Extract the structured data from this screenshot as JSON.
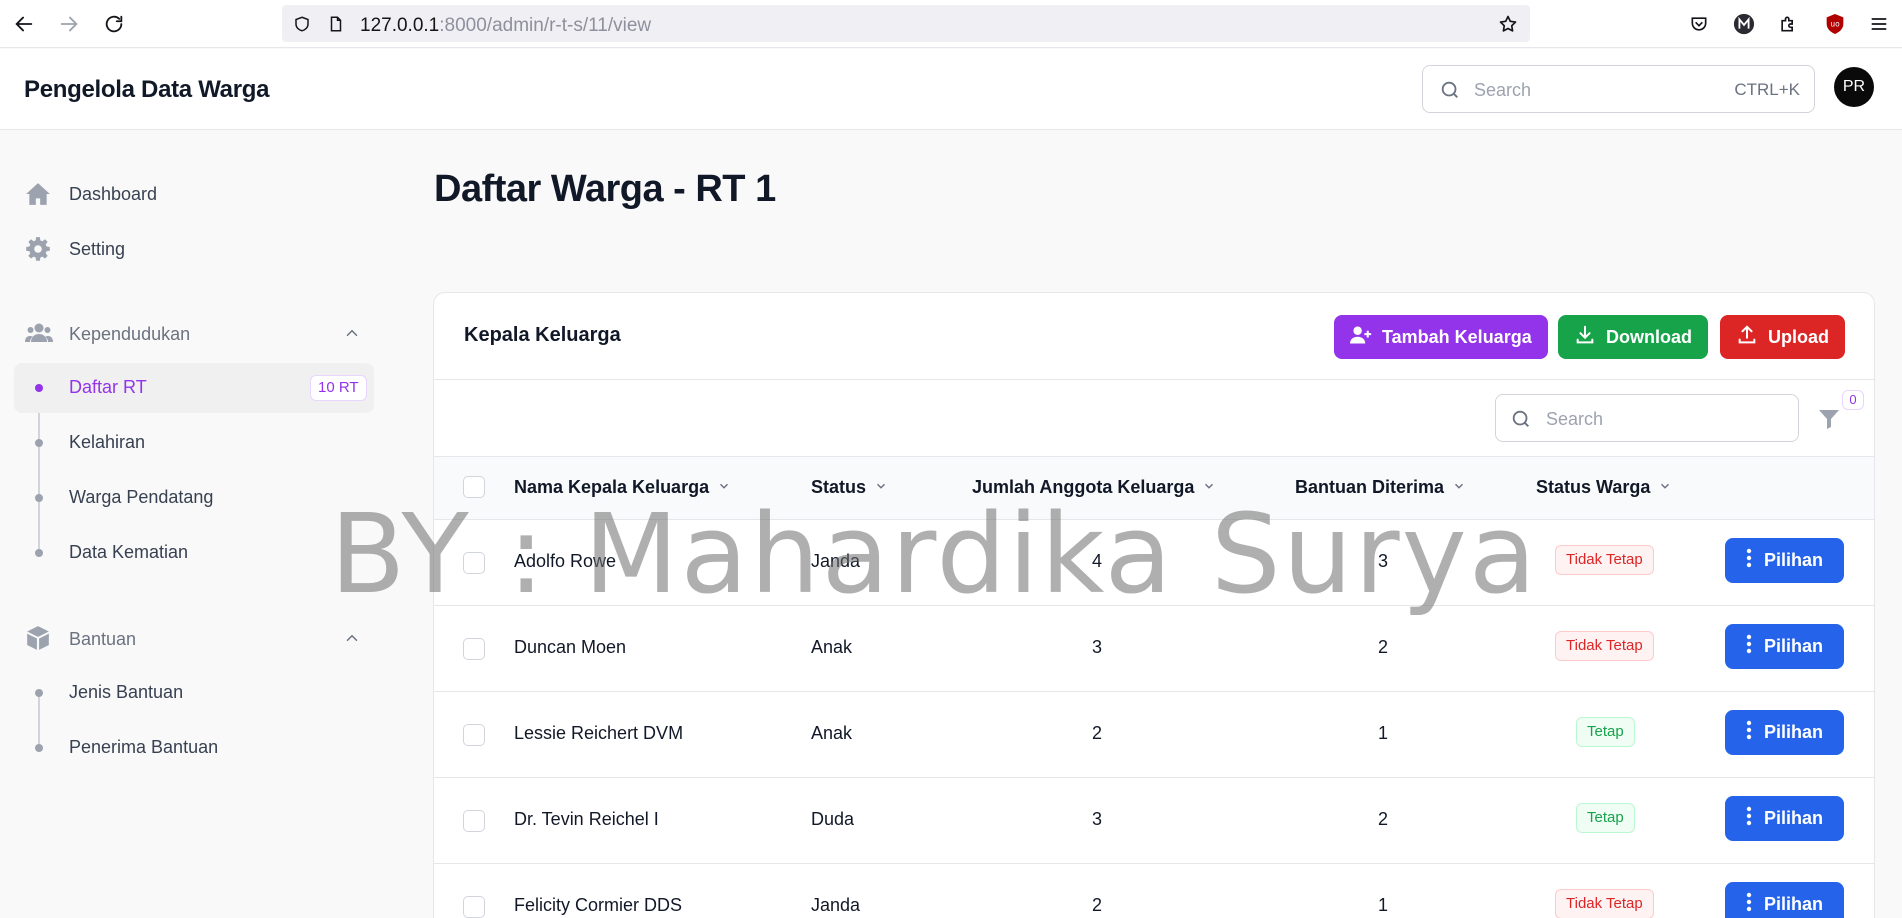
{
  "browser": {
    "url_host": "127.0.0.1",
    "url_path": ":8000/admin/r-t-s/11/view"
  },
  "header": {
    "brand": "Pengelola Data Warga",
    "search_placeholder": "Search",
    "search_shortcut": "CTRL+K",
    "avatar_initials": "PR"
  },
  "sidebar": {
    "dashboard": "Dashboard",
    "setting": "Setting",
    "group_kependudukan": "Kependudukan",
    "daftar_rt": "Daftar RT",
    "daftar_rt_badge": "10 RT",
    "kelahiran": "Kelahiran",
    "warga_pendatang": "Warga Pendatang",
    "data_kematian": "Data Kematian",
    "group_bantuan": "Bantuan",
    "jenis_bantuan": "Jenis Bantuan",
    "penerima_bantuan": "Penerima Bantuan"
  },
  "page": {
    "title": "Daftar Warga - RT 1"
  },
  "card": {
    "title": "Kepala Keluarga",
    "btn_tambah": "Tambah Keluarga",
    "btn_download": "Download",
    "btn_upload": "Upload",
    "search_placeholder": "Search",
    "filter_count": "0"
  },
  "table": {
    "columns": [
      "Nama Kepala Keluarga",
      "Status",
      "Jumlah Anggota Keluarga",
      "Bantuan Diterima",
      "Status Warga"
    ],
    "action_label": "Pilihan",
    "rows": [
      {
        "nama": "Adolfo Rowe",
        "status": "Janda",
        "jumlah": "4",
        "bantuan": "3",
        "status_warga": "Tidak Tetap"
      },
      {
        "nama": "Duncan Moen",
        "status": "Anak",
        "jumlah": "3",
        "bantuan": "2",
        "status_warga": "Tidak Tetap"
      },
      {
        "nama": "Lessie Reichert DVM",
        "status": "Anak",
        "jumlah": "2",
        "bantuan": "1",
        "status_warga": "Tetap"
      },
      {
        "nama": "Dr. Tevin Reichel I",
        "status": "Duda",
        "jumlah": "3",
        "bantuan": "2",
        "status_warga": "Tetap"
      },
      {
        "nama": "Felicity Cormier DDS",
        "status": "Janda",
        "jumlah": "2",
        "bantuan": "1",
        "status_warga": "Tidak Tetap"
      }
    ]
  },
  "watermark": "BY : Mahardika Surya",
  "colors": {
    "accent": "#9333ea",
    "success": "#16a34a",
    "danger": "#dc2626",
    "primary": "#2563eb"
  }
}
